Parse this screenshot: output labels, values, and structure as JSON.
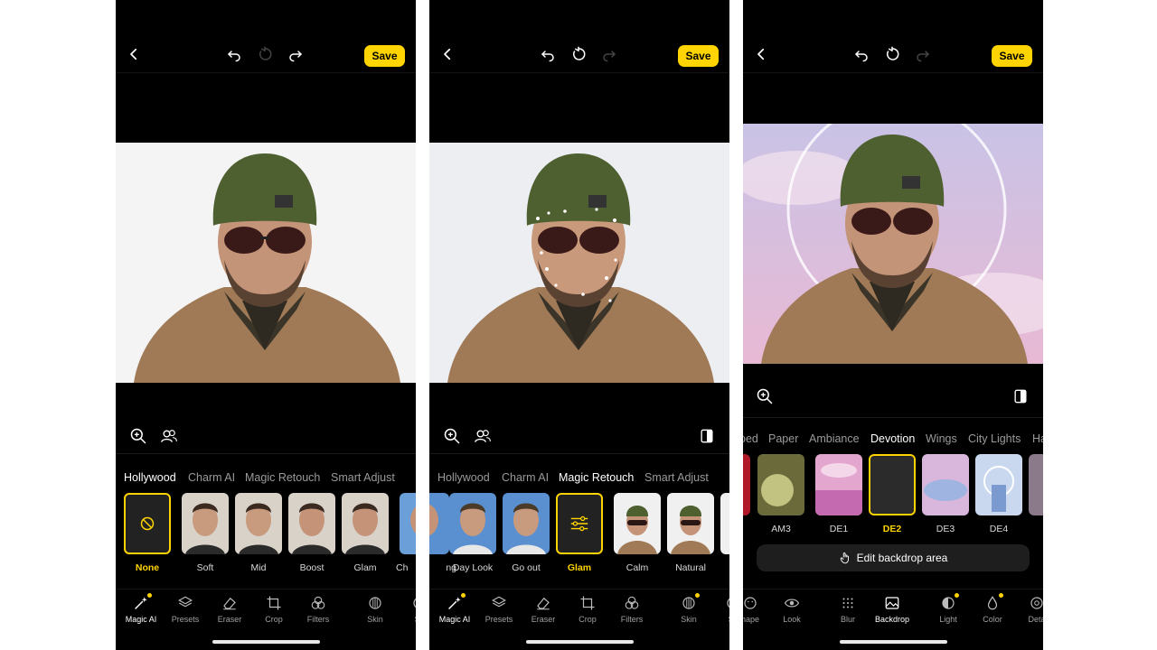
{
  "topbar": {
    "save_label": "Save"
  },
  "panel1": {
    "tabs": [
      "Hollywood",
      "Charm AI",
      "Magic Retouch",
      "Smart Adjust"
    ],
    "active_tab": "Hollywood",
    "thumbs": [
      "None",
      "Soft",
      "Mid",
      "Boost",
      "Glam",
      "Ch"
    ],
    "selected": "None",
    "nav": [
      "Magic AI",
      "Presets",
      "Eraser",
      "Crop",
      "Filters",
      "Skin",
      "Sh"
    ]
  },
  "panel2": {
    "tabs": [
      "Hollywood",
      "Charm AI",
      "Magic Retouch",
      "Smart Adjust"
    ],
    "active_tab": "Magic Retouch",
    "thumbs": [
      "ng",
      "Day Look",
      "Go out",
      "Glam",
      "Calm",
      "Natural"
    ],
    "selected": "Glam",
    "nav": [
      "Magic AI",
      "Presets",
      "Eraser",
      "Crop",
      "Filters",
      "Skin",
      "Sh"
    ]
  },
  "panel3": {
    "tabs": [
      "oed",
      "Paper",
      "Ambiance",
      "Devotion",
      "Wings",
      "City Lights",
      "Ha"
    ],
    "active_tab": "Devotion",
    "thumbs": [
      "AM3",
      "DE1",
      "DE2",
      "DE3",
      "DE4"
    ],
    "selected": "DE2",
    "edit_backdrop_label": "Edit backdrop area",
    "nav": [
      "hape",
      "Look",
      "Blur",
      "Backdrop",
      "Light",
      "Color",
      "Deta"
    ]
  },
  "icons": {
    "back": "chevron-left-icon",
    "undo": "undo-icon",
    "reset": "reset-icon",
    "redo": "redo-icon",
    "zoom": "zoom-in-icon",
    "faces": "faces-icon",
    "compare": "compare-icon",
    "disabled": "disabled-icon",
    "sliders": "sliders-icon",
    "hand": "hand-pointer-icon"
  },
  "colors": {
    "accent": "#ffd400",
    "background": "#000000",
    "inactive_text": "#9a9a9a"
  }
}
